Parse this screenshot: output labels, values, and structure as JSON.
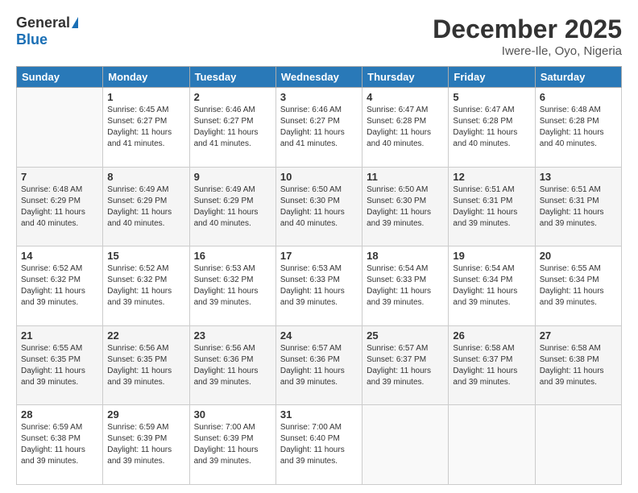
{
  "header": {
    "logo_general": "General",
    "logo_blue": "Blue",
    "month_title": "December 2025",
    "location": "Iwere-Ile, Oyo, Nigeria"
  },
  "days_of_week": [
    "Sunday",
    "Monday",
    "Tuesday",
    "Wednesday",
    "Thursday",
    "Friday",
    "Saturday"
  ],
  "weeks": [
    [
      {
        "num": "",
        "sunrise": "",
        "sunset": "",
        "daylight": ""
      },
      {
        "num": "1",
        "sunrise": "Sunrise: 6:45 AM",
        "sunset": "Sunset: 6:27 PM",
        "daylight": "Daylight: 11 hours and 41 minutes."
      },
      {
        "num": "2",
        "sunrise": "Sunrise: 6:46 AM",
        "sunset": "Sunset: 6:27 PM",
        "daylight": "Daylight: 11 hours and 41 minutes."
      },
      {
        "num": "3",
        "sunrise": "Sunrise: 6:46 AM",
        "sunset": "Sunset: 6:27 PM",
        "daylight": "Daylight: 11 hours and 41 minutes."
      },
      {
        "num": "4",
        "sunrise": "Sunrise: 6:47 AM",
        "sunset": "Sunset: 6:28 PM",
        "daylight": "Daylight: 11 hours and 40 minutes."
      },
      {
        "num": "5",
        "sunrise": "Sunrise: 6:47 AM",
        "sunset": "Sunset: 6:28 PM",
        "daylight": "Daylight: 11 hours and 40 minutes."
      },
      {
        "num": "6",
        "sunrise": "Sunrise: 6:48 AM",
        "sunset": "Sunset: 6:28 PM",
        "daylight": "Daylight: 11 hours and 40 minutes."
      }
    ],
    [
      {
        "num": "7",
        "sunrise": "Sunrise: 6:48 AM",
        "sunset": "Sunset: 6:29 PM",
        "daylight": "Daylight: 11 hours and 40 minutes."
      },
      {
        "num": "8",
        "sunrise": "Sunrise: 6:49 AM",
        "sunset": "Sunset: 6:29 PM",
        "daylight": "Daylight: 11 hours and 40 minutes."
      },
      {
        "num": "9",
        "sunrise": "Sunrise: 6:49 AM",
        "sunset": "Sunset: 6:29 PM",
        "daylight": "Daylight: 11 hours and 40 minutes."
      },
      {
        "num": "10",
        "sunrise": "Sunrise: 6:50 AM",
        "sunset": "Sunset: 6:30 PM",
        "daylight": "Daylight: 11 hours and 40 minutes."
      },
      {
        "num": "11",
        "sunrise": "Sunrise: 6:50 AM",
        "sunset": "Sunset: 6:30 PM",
        "daylight": "Daylight: 11 hours and 39 minutes."
      },
      {
        "num": "12",
        "sunrise": "Sunrise: 6:51 AM",
        "sunset": "Sunset: 6:31 PM",
        "daylight": "Daylight: 11 hours and 39 minutes."
      },
      {
        "num": "13",
        "sunrise": "Sunrise: 6:51 AM",
        "sunset": "Sunset: 6:31 PM",
        "daylight": "Daylight: 11 hours and 39 minutes."
      }
    ],
    [
      {
        "num": "14",
        "sunrise": "Sunrise: 6:52 AM",
        "sunset": "Sunset: 6:32 PM",
        "daylight": "Daylight: 11 hours and 39 minutes."
      },
      {
        "num": "15",
        "sunrise": "Sunrise: 6:52 AM",
        "sunset": "Sunset: 6:32 PM",
        "daylight": "Daylight: 11 hours and 39 minutes."
      },
      {
        "num": "16",
        "sunrise": "Sunrise: 6:53 AM",
        "sunset": "Sunset: 6:32 PM",
        "daylight": "Daylight: 11 hours and 39 minutes."
      },
      {
        "num": "17",
        "sunrise": "Sunrise: 6:53 AM",
        "sunset": "Sunset: 6:33 PM",
        "daylight": "Daylight: 11 hours and 39 minutes."
      },
      {
        "num": "18",
        "sunrise": "Sunrise: 6:54 AM",
        "sunset": "Sunset: 6:33 PM",
        "daylight": "Daylight: 11 hours and 39 minutes."
      },
      {
        "num": "19",
        "sunrise": "Sunrise: 6:54 AM",
        "sunset": "Sunset: 6:34 PM",
        "daylight": "Daylight: 11 hours and 39 minutes."
      },
      {
        "num": "20",
        "sunrise": "Sunrise: 6:55 AM",
        "sunset": "Sunset: 6:34 PM",
        "daylight": "Daylight: 11 hours and 39 minutes."
      }
    ],
    [
      {
        "num": "21",
        "sunrise": "Sunrise: 6:55 AM",
        "sunset": "Sunset: 6:35 PM",
        "daylight": "Daylight: 11 hours and 39 minutes."
      },
      {
        "num": "22",
        "sunrise": "Sunrise: 6:56 AM",
        "sunset": "Sunset: 6:35 PM",
        "daylight": "Daylight: 11 hours and 39 minutes."
      },
      {
        "num": "23",
        "sunrise": "Sunrise: 6:56 AM",
        "sunset": "Sunset: 6:36 PM",
        "daylight": "Daylight: 11 hours and 39 minutes."
      },
      {
        "num": "24",
        "sunrise": "Sunrise: 6:57 AM",
        "sunset": "Sunset: 6:36 PM",
        "daylight": "Daylight: 11 hours and 39 minutes."
      },
      {
        "num": "25",
        "sunrise": "Sunrise: 6:57 AM",
        "sunset": "Sunset: 6:37 PM",
        "daylight": "Daylight: 11 hours and 39 minutes."
      },
      {
        "num": "26",
        "sunrise": "Sunrise: 6:58 AM",
        "sunset": "Sunset: 6:37 PM",
        "daylight": "Daylight: 11 hours and 39 minutes."
      },
      {
        "num": "27",
        "sunrise": "Sunrise: 6:58 AM",
        "sunset": "Sunset: 6:38 PM",
        "daylight": "Daylight: 11 hours and 39 minutes."
      }
    ],
    [
      {
        "num": "28",
        "sunrise": "Sunrise: 6:59 AM",
        "sunset": "Sunset: 6:38 PM",
        "daylight": "Daylight: 11 hours and 39 minutes."
      },
      {
        "num": "29",
        "sunrise": "Sunrise: 6:59 AM",
        "sunset": "Sunset: 6:39 PM",
        "daylight": "Daylight: 11 hours and 39 minutes."
      },
      {
        "num": "30",
        "sunrise": "Sunrise: 7:00 AM",
        "sunset": "Sunset: 6:39 PM",
        "daylight": "Daylight: 11 hours and 39 minutes."
      },
      {
        "num": "31",
        "sunrise": "Sunrise: 7:00 AM",
        "sunset": "Sunset: 6:40 PM",
        "daylight": "Daylight: 11 hours and 39 minutes."
      },
      {
        "num": "",
        "sunrise": "",
        "sunset": "",
        "daylight": ""
      },
      {
        "num": "",
        "sunrise": "",
        "sunset": "",
        "daylight": ""
      },
      {
        "num": "",
        "sunrise": "",
        "sunset": "",
        "daylight": ""
      }
    ]
  ]
}
